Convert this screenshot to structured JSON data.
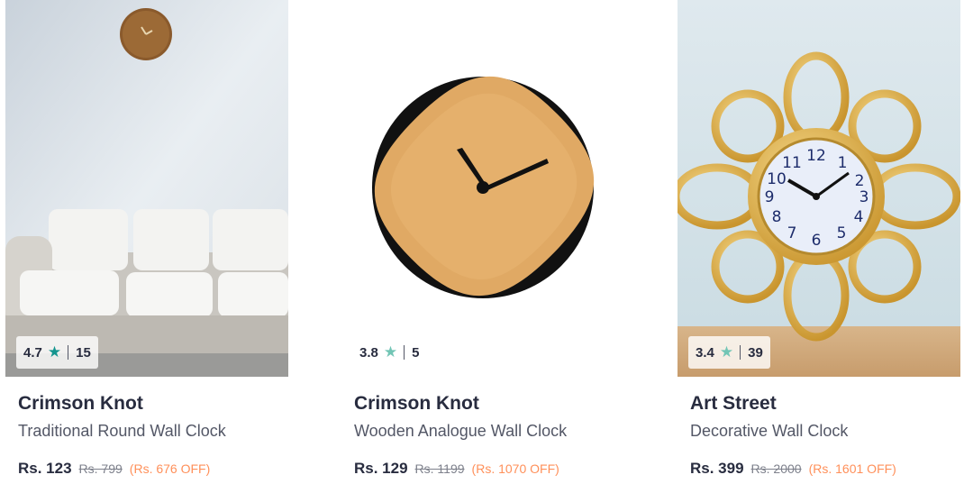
{
  "products": [
    {
      "brand": "Crimson Knot",
      "name": "Traditional Round Wall Clock",
      "rating": "4.7",
      "rating_count": "15",
      "price": "Rs. 123",
      "mrp": "Rs. 799",
      "discount": "(Rs. 676 OFF)"
    },
    {
      "brand": "Crimson Knot",
      "name": "Wooden Analogue Wall Clock",
      "rating": "3.8",
      "rating_count": "5",
      "price": "Rs. 129",
      "mrp": "Rs. 1199",
      "discount": "(Rs. 1070 OFF)"
    },
    {
      "brand": "Art Street",
      "name": "Decorative Wall Clock",
      "rating": "3.4",
      "rating_count": "39",
      "price": "Rs. 399",
      "mrp": "Rs. 2000",
      "discount": "(Rs. 1601 OFF)"
    }
  ],
  "colors": {
    "star": "#14958f",
    "discount": "#ff905a",
    "brand_text": "#282c3f",
    "muted_text": "#7e818c"
  },
  "icons": {
    "rating": "star-icon"
  }
}
